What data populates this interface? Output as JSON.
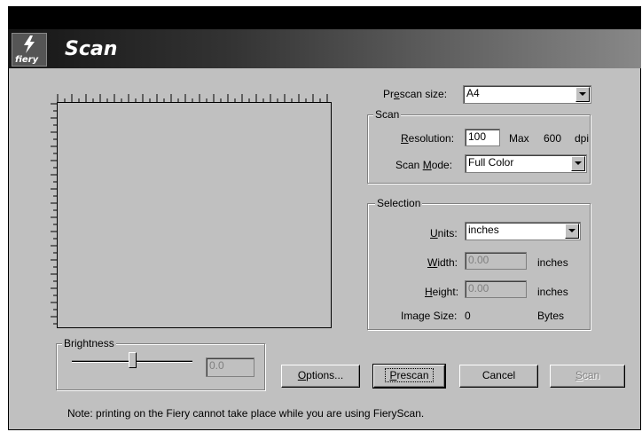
{
  "window": {
    "title": "Scan",
    "logo_text": "fiery"
  },
  "prescan": {
    "label_pre": "Pr",
    "label_accel": "e",
    "label_post": "scan size:",
    "value": "A4"
  },
  "scan_group": {
    "title": "Scan",
    "resolution": {
      "label_accel": "R",
      "label_rest": "esolution:",
      "value": "100",
      "max_label": "Max",
      "max_value": "600",
      "unit": "dpi"
    },
    "mode": {
      "label_pre": "Scan ",
      "label_accel": "M",
      "label_post": "ode:",
      "value": "Full Color"
    }
  },
  "selection_group": {
    "title": "Selection",
    "units": {
      "label_accel": "U",
      "label_rest": "nits:",
      "value": "inches"
    },
    "width": {
      "label_accel": "W",
      "label_rest": "idth:",
      "value": "0.00",
      "unit": "inches"
    },
    "height": {
      "label_accel": "H",
      "label_rest": "eight:",
      "value": "0.00",
      "unit": "inches"
    },
    "image_size": {
      "label": "Image Size:",
      "value": "0",
      "unit": "Bytes"
    }
  },
  "brightness": {
    "title": "Brightness",
    "value": "0.0",
    "level": 0.5
  },
  "buttons": {
    "options": {
      "accel": "O",
      "rest": "ptions..."
    },
    "prescan": {
      "accel": "P",
      "rest": "rescan"
    },
    "cancel": "Cancel",
    "scan": {
      "accel": "S",
      "rest": "can"
    }
  },
  "note": "Note: printing on the Fiery cannot take place while you are using FieryScan."
}
